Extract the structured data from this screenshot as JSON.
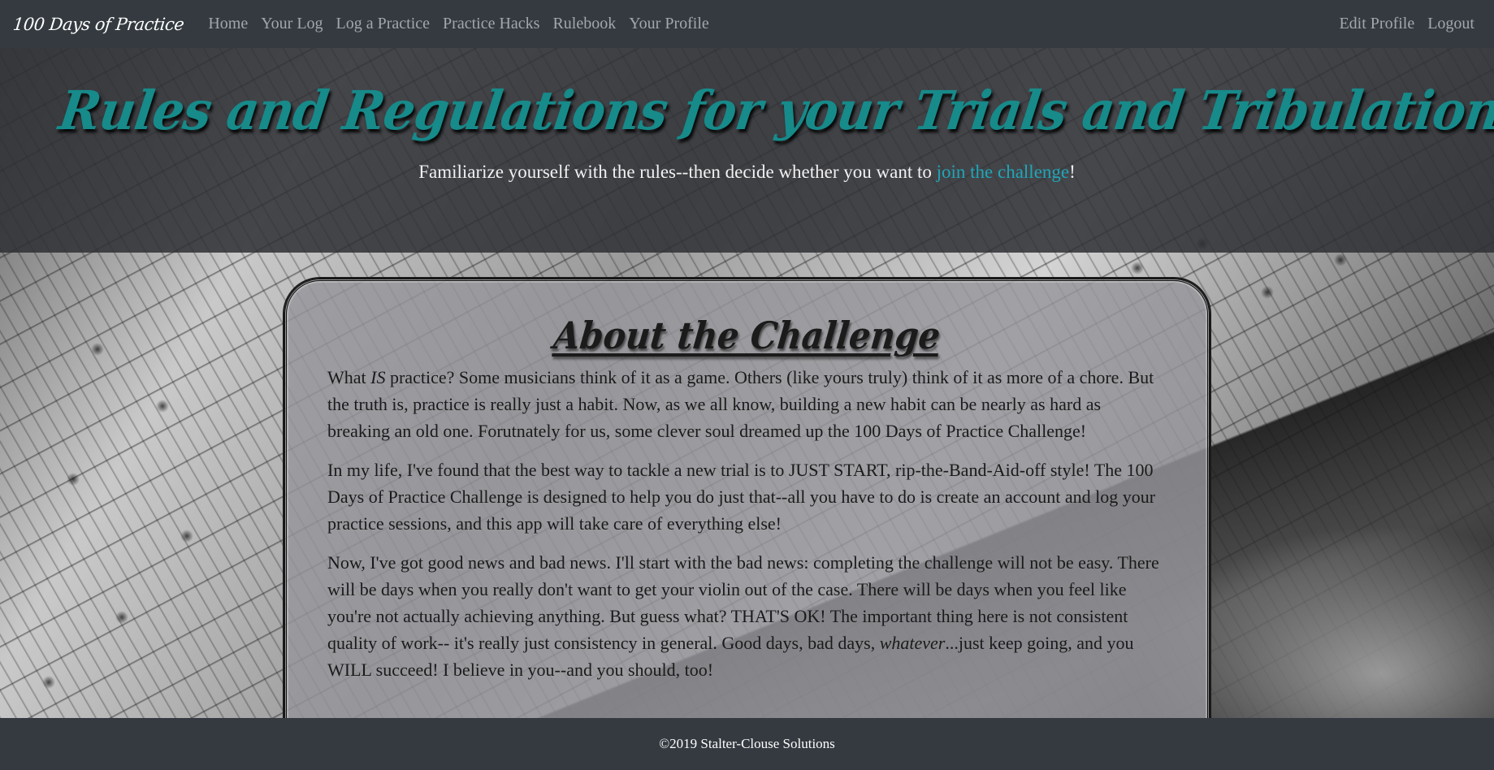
{
  "navbar": {
    "brand": "100 Days of Practice",
    "links": [
      "Home",
      "Your Log",
      "Log a Practice",
      "Practice Hacks",
      "Rulebook",
      "Your Profile"
    ],
    "right_links": [
      "Edit Profile",
      "Logout"
    ]
  },
  "hero": {
    "title": "Rules and Regulations for your Trials and Tribulations",
    "subtitle_before": "Familiarize yourself with the rules--then decide whether you want to ",
    "subtitle_link": "join the challenge",
    "subtitle_after": "!"
  },
  "card": {
    "title": "About the Challenge",
    "p1_a": "What ",
    "p1_em": "IS",
    "p1_b": " practice? Some musicians think of it as a game. Others (like yours truly) think of it as more of a chore. But the truth is, practice is really just a habit. Now, as we all know, building a new habit can be nearly as hard as breaking an old one. Forutnately for us, some clever soul dreamed up the 100 Days of Practice Challenge!",
    "p2": "In my life, I've found that the best way to tackle a new trial is to JUST START, rip-the-Band-Aid-off style! The 100 Days of Practice Challenge is designed to help you do just that--all you have to do is create an account and log your practice sessions, and this app will take care of everything else!",
    "p3_a": "Now, I've got good news and bad news. I'll start with the bad news: completing the challenge will not be easy. There will be days when you really don't want to get your violin out of the case. There will be days when you feel like you're not actually achieving anything. But guess what? THAT'S OK! The important thing here is not consistent quality of work-- it's really just consistency in general. Good days, bad days, ",
    "p3_em": "whatever",
    "p3_b": "...just keep going, and you WILL succeed! I believe in you--and you should, too!"
  },
  "footer": {
    "text": "©2019 Stalter-Clouse Solutions"
  },
  "colors": {
    "navbar_bg": "#343a40",
    "title_teal": "#178a8a",
    "link_teal": "#1fa6b8"
  }
}
